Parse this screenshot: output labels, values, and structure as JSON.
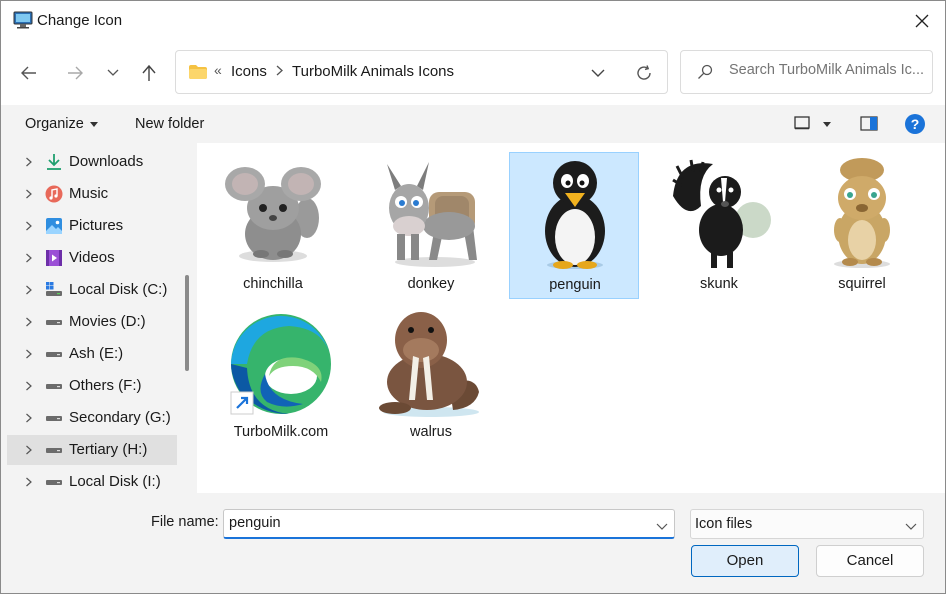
{
  "window": {
    "title": "Change Icon"
  },
  "address": {
    "overflow_chevron": "«",
    "breadcrumbs": [
      "Icons",
      "TurboMilk Animals Icons"
    ]
  },
  "search": {
    "placeholder": "Search TurboMilk Animals Ic..."
  },
  "toolbar": {
    "organize": "Organize",
    "new_folder": "New folder",
    "help": "?"
  },
  "navigation": {
    "items": [
      {
        "label": "Downloads",
        "icon": "download-icon"
      },
      {
        "label": "Music",
        "icon": "music-icon"
      },
      {
        "label": "Pictures",
        "icon": "pictures-icon"
      },
      {
        "label": "Videos",
        "icon": "videos-icon"
      },
      {
        "label": "Local Disk (C:)",
        "icon": "system-drive-icon"
      },
      {
        "label": "Movies (D:)",
        "icon": "drive-icon"
      },
      {
        "label": "Ash (E:)",
        "icon": "drive-icon"
      },
      {
        "label": "Others (F:)",
        "icon": "drive-icon"
      },
      {
        "label": "Secondary (G:)",
        "icon": "drive-icon"
      },
      {
        "label": "Tertiary (H:)",
        "icon": "drive-icon",
        "selected": true
      },
      {
        "label": "Local Disk (I:)",
        "icon": "drive-icon"
      }
    ]
  },
  "files": [
    {
      "name": "chinchilla",
      "icon": "chinchilla-icon"
    },
    {
      "name": "donkey",
      "icon": "donkey-icon"
    },
    {
      "name": "penguin",
      "icon": "penguin-icon",
      "selected": true
    },
    {
      "name": "skunk",
      "icon": "skunk-icon"
    },
    {
      "name": "squirrel",
      "icon": "squirrel-icon"
    },
    {
      "name": "TurboMilk.com",
      "icon": "edge-shortcut-icon"
    },
    {
      "name": "walrus",
      "icon": "walrus-icon"
    }
  ],
  "footer": {
    "file_name_label": "File name:",
    "file_name_value": "penguin",
    "file_type": "Icon files",
    "open_label": "Open",
    "cancel_label": "Cancel"
  },
  "colors": {
    "accent": "#0067c0",
    "selection_bg": "#cce8ff",
    "selection_border": "#99d1ff",
    "pane_bg": "#f3f3f3"
  }
}
